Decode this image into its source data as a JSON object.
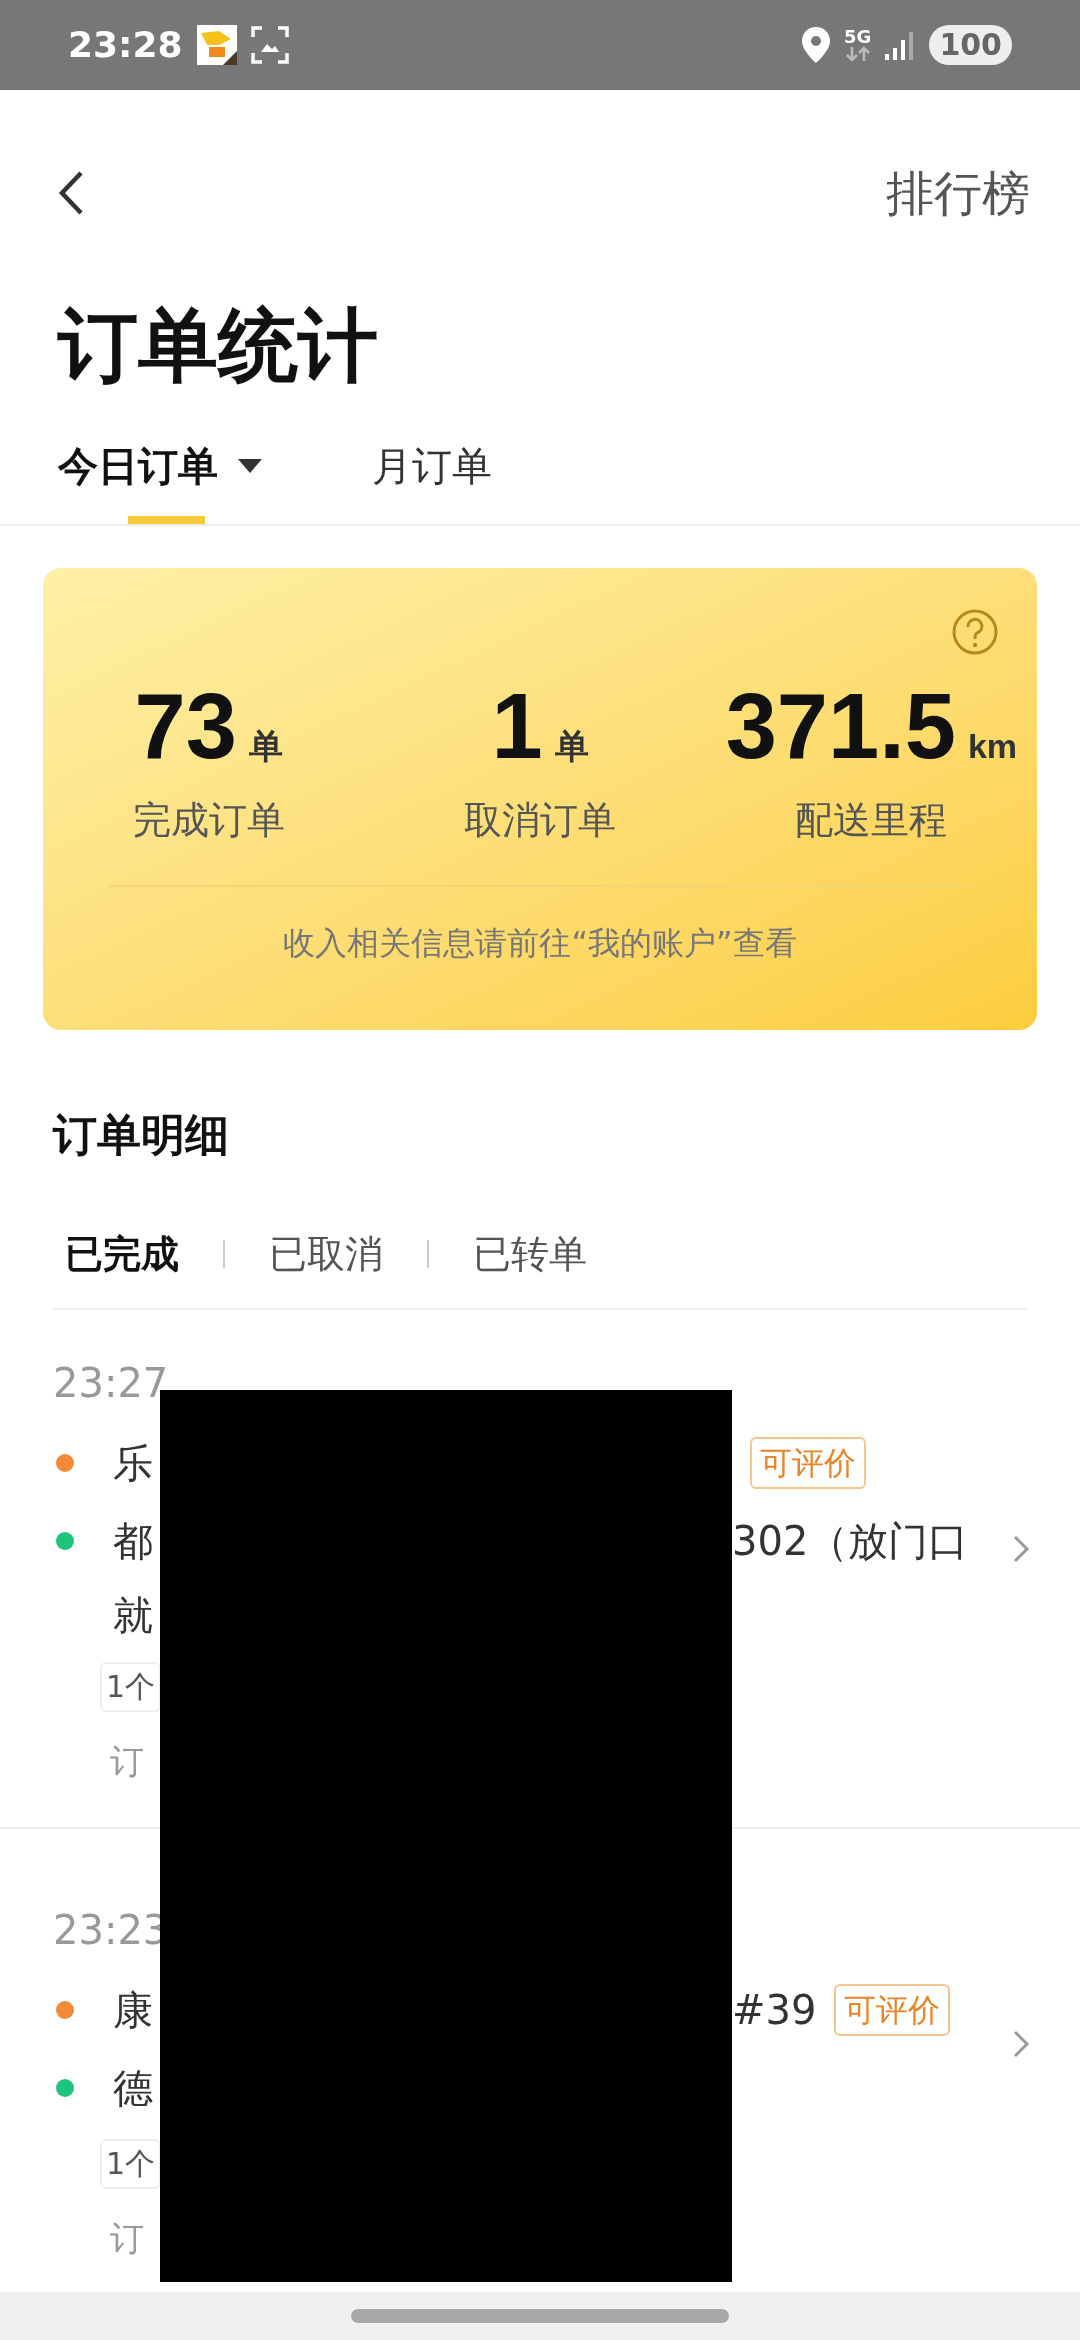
{
  "status_bar": {
    "time": "23:28",
    "network": "5G",
    "battery": "100"
  },
  "header": {
    "ranking_link": "排行榜"
  },
  "page_title": "订单统计",
  "tabs": [
    {
      "label": "今日订单",
      "selected": true,
      "dropdown": true
    },
    {
      "label": "月订单",
      "selected": false,
      "dropdown": false
    }
  ],
  "summary": {
    "stats": [
      {
        "value": "73",
        "unit": "单",
        "label": "完成订单"
      },
      {
        "value": "1",
        "unit": "单",
        "label": "取消订单"
      },
      {
        "value": "371.5",
        "unit": "km",
        "label": "配送里程"
      }
    ],
    "note": "收入相关信息请前往“我的账户”查看"
  },
  "detail_title": "订单明细",
  "filter_tabs": [
    {
      "label": "已完成",
      "selected": true
    },
    {
      "label": "已取消",
      "selected": false
    },
    {
      "label": "已转单",
      "selected": false
    }
  ],
  "orders": [
    {
      "time": "23:27",
      "badge": "可评价",
      "stops": [
        {
          "kind": "pickup",
          "lines": [
            "乐"
          ]
        },
        {
          "kind": "dropoff",
          "lines": [
            "都",
            "就"
          ],
          "end": "302（放门口"
        }
      ],
      "items_tag": "1个",
      "footer": "订"
    },
    {
      "time": "23:23",
      "badge": "可评价",
      "stops": [
        {
          "kind": "pickup",
          "lines": [
            "康"
          ],
          "end": "#39"
        },
        {
          "kind": "dropoff",
          "lines": [
            "德"
          ]
        }
      ],
      "items_tag": "1个",
      "footer": "订"
    }
  ]
}
